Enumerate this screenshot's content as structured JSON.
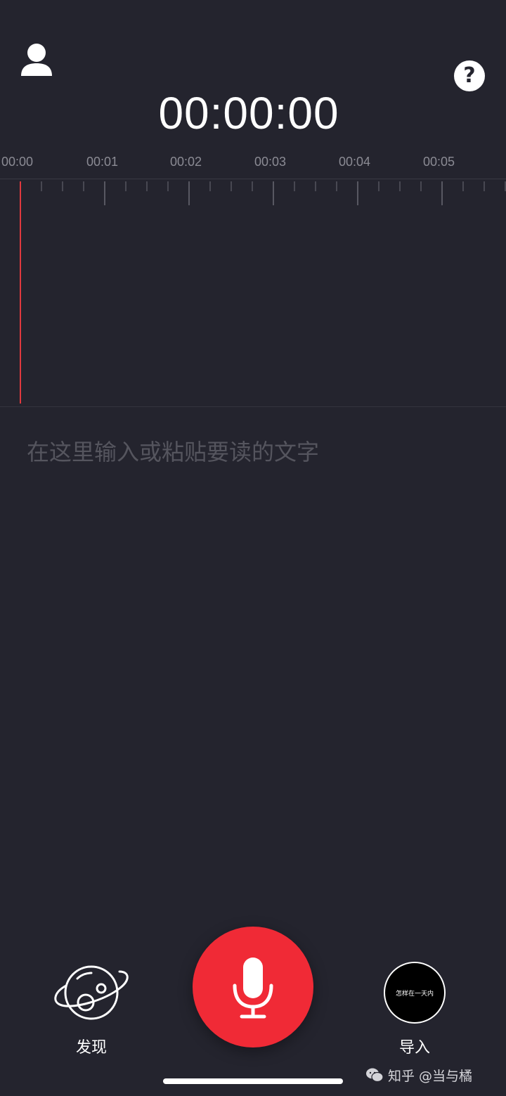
{
  "header": {
    "profile_icon": "person-icon",
    "help_label": "?",
    "timer": "00:00:00"
  },
  "timeline": {
    "labels": [
      "00:00",
      "00:01",
      "00:02",
      "00:03",
      "00:04",
      "00:05"
    ],
    "playhead_color": "#e0393e"
  },
  "editor": {
    "placeholder": "在这里输入或粘贴要读的文字",
    "value": ""
  },
  "bottom_bar": {
    "discover_label": "发现",
    "discover_icon": "planet-icon",
    "record_icon": "microphone-icon",
    "record_color": "#f02a36",
    "import_label": "导入",
    "import_thumb_text": "怎样在一天内"
  },
  "watermark": {
    "text": "知乎 @当与橘",
    "icon": "wechat-icon"
  },
  "colors": {
    "background": "#24242e",
    "ruler_text": "#8b8b94",
    "placeholder": "#55555e"
  }
}
